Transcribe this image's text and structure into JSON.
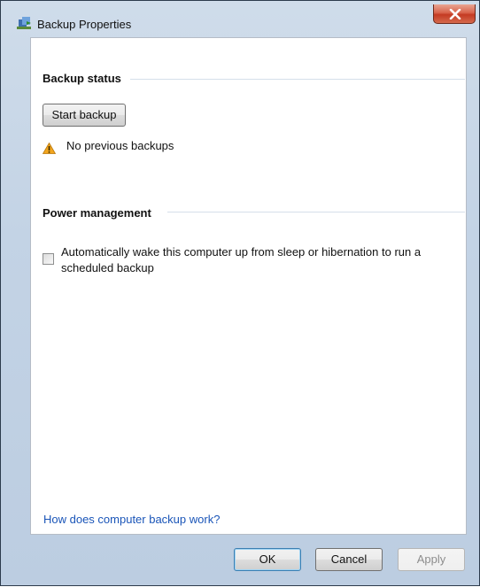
{
  "window": {
    "title": "Backup Properties",
    "close_label": "X"
  },
  "backup_status": {
    "heading": "Backup status",
    "start_button": "Start backup",
    "status_text": "No previous backups"
  },
  "power_management": {
    "heading": "Power management",
    "checkbox_label": "Automatically wake this computer up from sleep or hibernation to run a scheduled backup",
    "checked": false
  },
  "help_link": "How does computer backup work?",
  "buttons": {
    "ok": "OK",
    "cancel": "Cancel",
    "apply": "Apply"
  },
  "icons": {
    "title": "backup-app-icon",
    "close": "close-icon",
    "status": "warning-icon"
  }
}
